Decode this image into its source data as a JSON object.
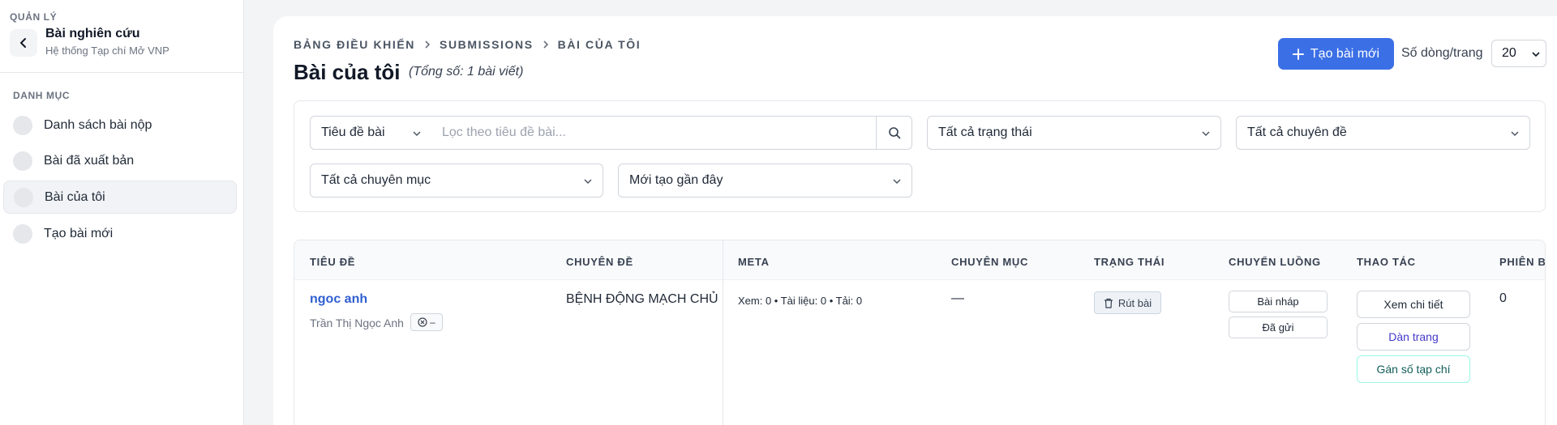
{
  "sidebar": {
    "section_label": "QUẢN LÝ",
    "title": "Bài nghiên cứu",
    "subtitle": "Hệ thống Tạp chí Mở VNP",
    "category_label": "DANH MỤC",
    "items": [
      {
        "label": "Danh sách bài nộp",
        "active": false
      },
      {
        "label": "Bài đã xuất bản",
        "active": false
      },
      {
        "label": "Bài của tôi",
        "active": true
      },
      {
        "label": "Tạo bài mới",
        "active": false
      }
    ]
  },
  "header": {
    "breadcrumb": [
      "BẢNG ĐIỀU KHIỂN",
      "SUBMISSIONS",
      "BÀI CỦA TÔI"
    ],
    "title": "Bài của tôi",
    "count": "(Tổng số: 1 bài viết)",
    "create_button": "Tạo bài mới",
    "rows_label": "Số dòng/trang",
    "rows_value": "20"
  },
  "filters": {
    "search_field": "Tiêu đề bài",
    "search_placeholder": "Lọc theo tiêu đề bài...",
    "status": "Tất cả trạng thái",
    "topic": "Tất cả chuyên đề",
    "category": "Tất cả chuyên mục",
    "sort": "Mới tạo gần đây"
  },
  "table": {
    "columns": [
      "TIÊU ĐỀ",
      "CHUYÊN ĐỀ",
      "META",
      "CHUYÊN MỤC",
      "TRẠNG THÁI",
      "CHUYỂN LUỒNG",
      "THAO TÁC",
      "PHIÊN B..."
    ],
    "rows": [
      {
        "title": "ngoc anh",
        "author": "Trần Thị Ngọc Anh",
        "badge": "–",
        "topic": "BỆNH ĐỘNG MẠCH CHỦ",
        "meta": "Xem: 0 • Tài liệu: 0 • Tải: 0",
        "category": "—",
        "status_action": "Rút bài",
        "flow": [
          "Bài nháp",
          "Đã gửi"
        ],
        "actions": [
          "Xem chi tiết",
          "Dàn trang",
          "Gán số tạp chí"
        ],
        "version": "0"
      }
    ]
  },
  "colors": {
    "primary": "#3b6fe6",
    "link": "#2f5fcf",
    "background": "#f3f4f6"
  }
}
